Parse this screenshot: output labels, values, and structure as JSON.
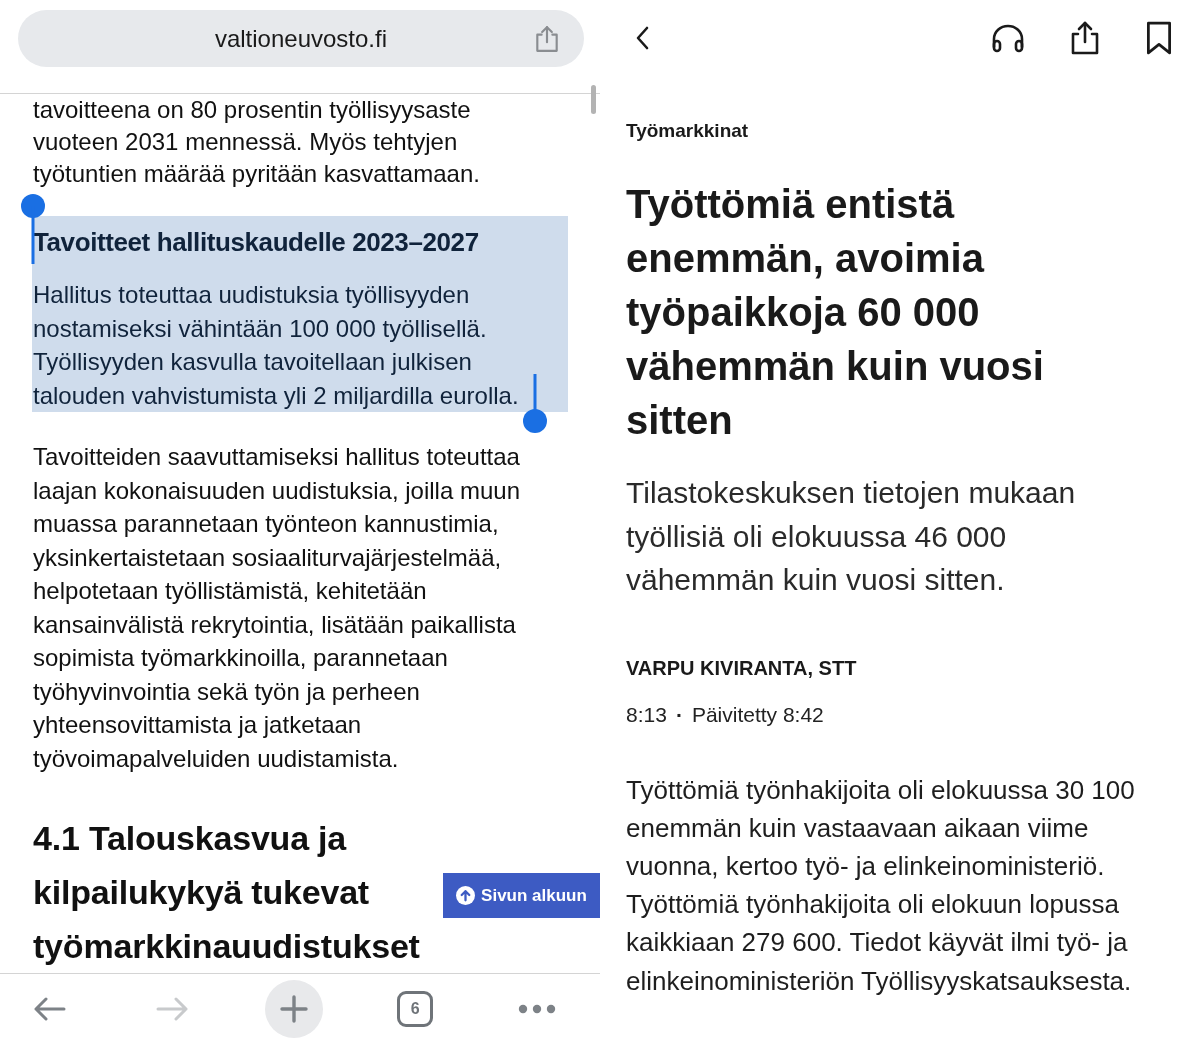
{
  "browser": {
    "address_bar": {
      "url": "valtioneuvosto.fi"
    },
    "page": {
      "blocks": [
        {
          "kind": "paragraph",
          "text": "tavoitteena on 80 prosentin työllisyysaste vuoteen 2031 mennessä. Myös tehtyjen työtuntien määrää pyritään kasvattamaan.",
          "selected": false
        },
        {
          "kind": "subheading",
          "text": "Tavoitteet hallituskaudelle 2023–2027",
          "selected": true
        },
        {
          "kind": "paragraph",
          "text": "Hallitus toteuttaa uudistuksia työllisyyden nostamiseksi vähintään 100 000 työllisellä. Työllisyyden kasvulla tavoitellaan julkisen talouden vahvistumista yli 2 miljardilla eurolla.",
          "selected": true
        },
        {
          "kind": "paragraph",
          "text": "Tavoitteiden saavuttamiseksi hallitus toteuttaa laajan kokonaisuuden uudistuksia, joilla muun muassa parannetaan työnteon kannustimia, yksinkertaistetaan sosiaaliturvajärjestelmää, helpotetaan työllistämistä, kehitetään kansainvälistä rekrytointia, lisätään paikallista sopimista työmarkkinoilla, parannetaan työhyvinvointia sekä työn ja perheen yhteensovittamista ja jatketaan työvoimapalveluiden uudistamista.",
          "selected": false
        },
        {
          "kind": "heading",
          "text": "4.1 Talouskasvua ja kilpailukykyä tukevat työmarkkinauudistukset",
          "selected": false
        }
      ]
    },
    "back_to_top_button": {
      "label": "Sivun alkuun"
    },
    "toolbar": [
      {
        "kind": "back",
        "disabled": false
      },
      {
        "kind": "forward",
        "disabled": true
      },
      {
        "kind": "new_tab",
        "disabled": false
      },
      {
        "kind": "tabs",
        "count": "6",
        "disabled": false
      },
      {
        "kind": "more",
        "disabled": false
      }
    ]
  },
  "article": {
    "toolbar": [
      {
        "kind": "back"
      },
      {
        "kind": "listen"
      },
      {
        "kind": "share"
      },
      {
        "kind": "bookmark"
      }
    ],
    "category": "Työmarkkinat",
    "headline": "Työttömiä entistä enemmän, avoimia työpaikkoja 60 000 vähemmän kuin vuosi sitten",
    "lead": "Tilastokeskuksen tietojen mukaan työllisiä oli elokuussa 46 000 vähemmän kuin vuosi sitten.",
    "byline": "VARPU KIVIRANTA, STT",
    "published": "8:13",
    "separator": "·",
    "updated": "Päivitetty 8:42",
    "body": [
      "Työttömiä työnhakijoita oli elokuussa 30 100 enemmän kuin vastaavaan aikaan viime vuonna, kertoo työ- ja elinkeinoministeriö. Työttömiä työnhakijoita oli elokuun lopussa kaikkiaan 279 600. Tiedot käyvät ilmi työ- ja elinkeinoministeriön Työllisyyskatsauksesta."
    ]
  }
}
